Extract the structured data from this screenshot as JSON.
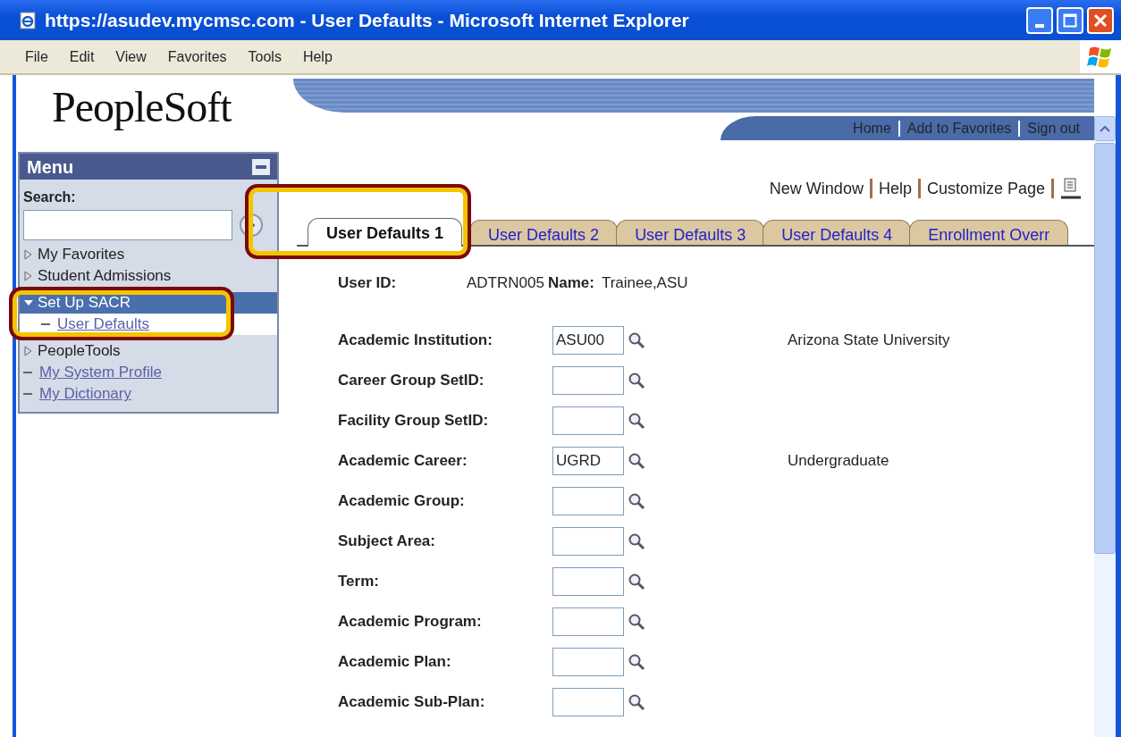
{
  "window": {
    "title": "https://asudev.mycmsc.com - User Defaults - Microsoft Internet Explorer"
  },
  "menu_bar": [
    "File",
    "Edit",
    "View",
    "Favorites",
    "Tools",
    "Help"
  ],
  "header": {
    "logo": "PeopleSoft",
    "links": [
      "Home",
      "Add to Favorites",
      "Sign out"
    ]
  },
  "sidebar": {
    "title": "Menu",
    "search_label": "Search:",
    "items": [
      {
        "label": "My Favorites",
        "kind": "folder",
        "expanded": false,
        "selected": false,
        "highlighted": false
      },
      {
        "label": "Student Admissions",
        "kind": "folder",
        "expanded": false,
        "selected": false,
        "highlighted": false
      },
      {
        "label": "Set Up SACR",
        "kind": "folder",
        "expanded": true,
        "selected": true,
        "highlighted": true,
        "children": [
          {
            "label": "User Defaults",
            "kind": "link",
            "selected": false
          }
        ]
      },
      {
        "label": "PeopleTools",
        "kind": "folder",
        "expanded": false,
        "selected": false,
        "highlighted": false
      },
      {
        "label": "My System Profile",
        "kind": "link",
        "selected": false,
        "highlighted": false
      },
      {
        "label": "My Dictionary",
        "kind": "link",
        "selected": false,
        "highlighted": false
      }
    ]
  },
  "page_links": [
    "New Window",
    "Help",
    "Customize Page"
  ],
  "tabs": [
    {
      "label": "User Defaults 1",
      "selected": true,
      "highlighted": true
    },
    {
      "label": "User Defaults 2",
      "selected": false,
      "highlighted": false
    },
    {
      "label": "User Defaults 3",
      "selected": false,
      "highlighted": false
    },
    {
      "label": "User Defaults 4",
      "selected": false,
      "highlighted": false
    },
    {
      "label": "Enrollment Overr",
      "selected": false,
      "highlighted": false
    }
  ],
  "user": {
    "id_label": "User ID:",
    "id_value": "ADTRN005",
    "name_label": "Name:",
    "name_value": "Trainee,ASU"
  },
  "fields": [
    {
      "label": "Academic Institution:",
      "value": "ASU00",
      "description": "Arizona State University"
    },
    {
      "label": "Career Group SetID:"
    },
    {
      "label": "Facility Group SetID:"
    },
    {
      "label": "Academic Career:",
      "value": "UGRD",
      "description": "Undergraduate"
    },
    {
      "label": "Academic Group:"
    },
    {
      "label": "Subject Area:"
    },
    {
      "label": "Term:"
    },
    {
      "label": "Academic Program:"
    },
    {
      "label": "Academic Plan:"
    },
    {
      "label": "Academic Sub-Plan:"
    }
  ]
}
